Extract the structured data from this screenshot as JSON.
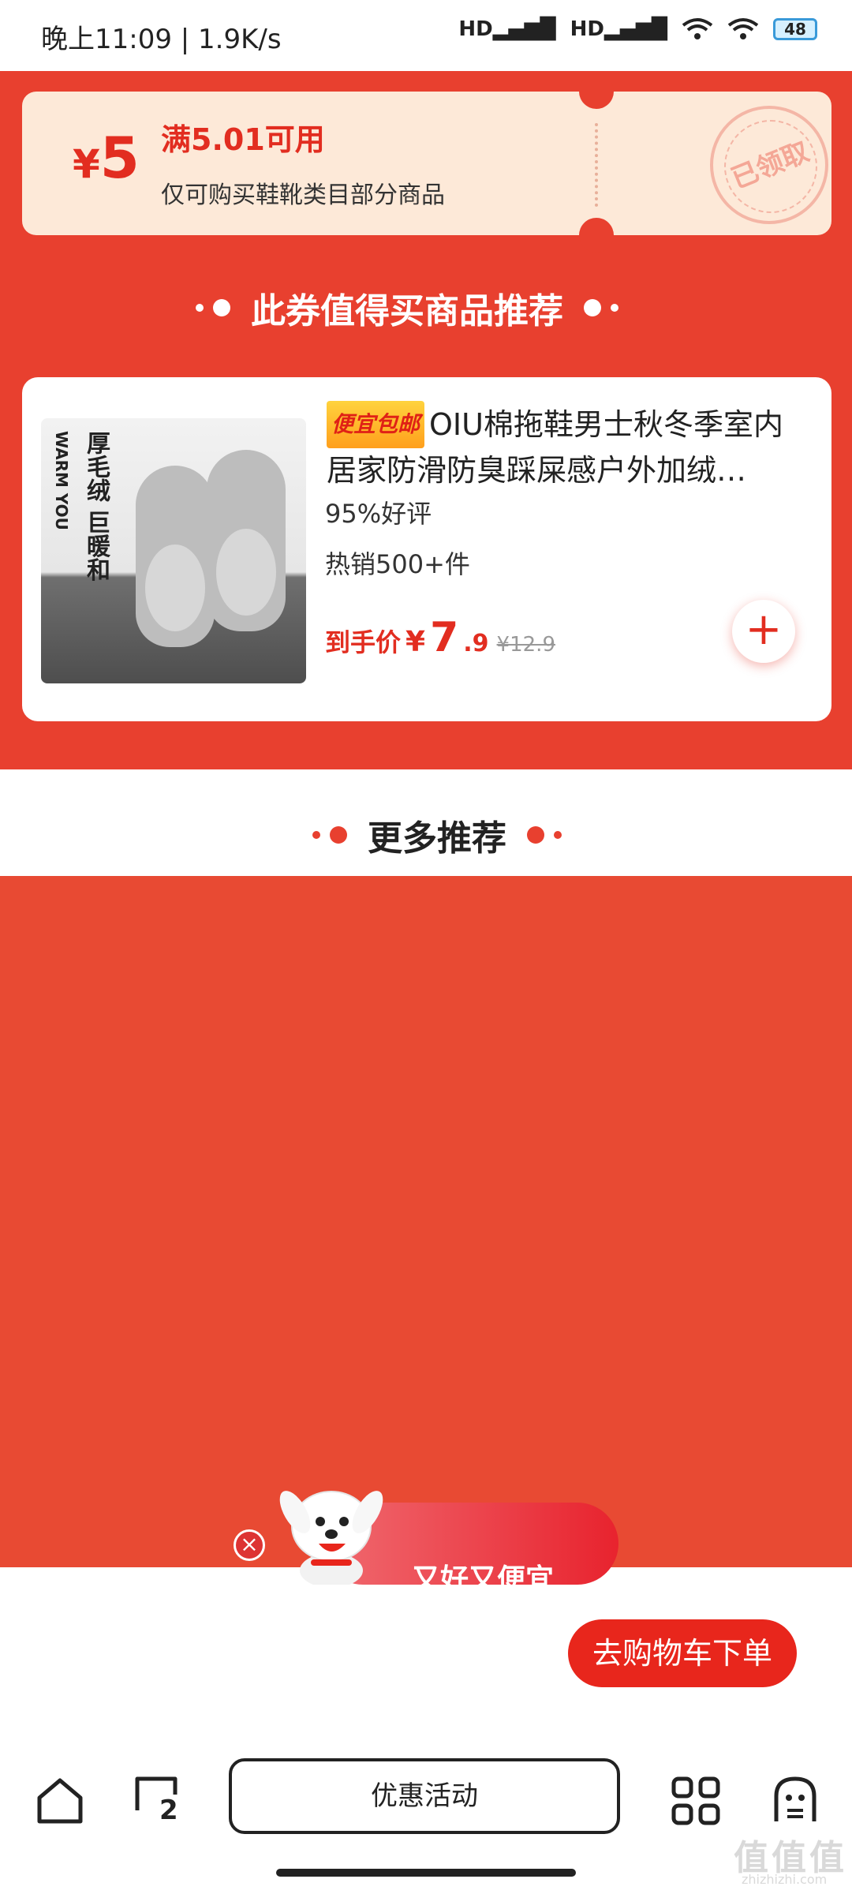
{
  "status_bar": {
    "time": "晚上11:09 | 1.9K/s",
    "network1": "HD",
    "network2": "HD",
    "battery": "48"
  },
  "coupon": {
    "currency": "¥",
    "amount": "5",
    "condition": "满5.01可用",
    "description": "仅可购买鞋靴类目部分商品",
    "stamp": "已领取"
  },
  "section_title": "此券值得买商品推荐",
  "product": {
    "image_text_en": "WARM YOU",
    "image_text_cn": "厚毛绒 巨暖和",
    "tag": "便宜包邮",
    "title": "OIU棉拖鞋男士秋冬季室内居家防滑防臭踩屎感户外加绒…",
    "rating": "95%好评",
    "sales": "热销500+件",
    "price_label": "到手价",
    "price_currency": "¥",
    "price_int": "7",
    "price_dec": ".9",
    "original_price": "¥12.9",
    "add_symbol": "+"
  },
  "more_title": "更多推荐",
  "promo": {
    "text": "又好又便宜",
    "close": "×"
  },
  "checkout_button": "去购物车下单",
  "bottom_nav": {
    "tabs_count": "2",
    "promo_tab": "优惠活动"
  },
  "watermark": "值值值",
  "watermark_sub": "zhizhizhi.com",
  "colors": {
    "primary_red": "#e8402f",
    "price_red": "#e22d20",
    "coupon_bg": "#fde9d8"
  }
}
